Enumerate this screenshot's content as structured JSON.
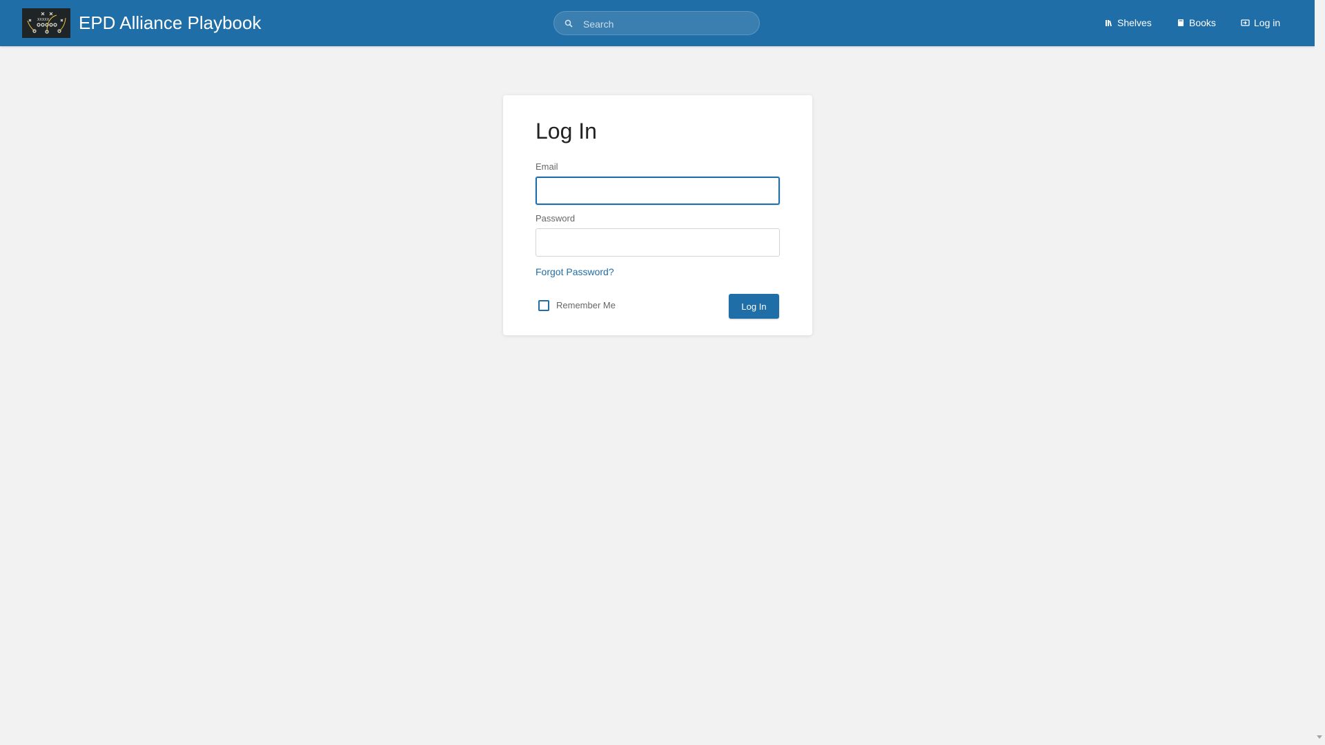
{
  "header": {
    "site_title": "EPD Alliance Playbook",
    "logo_icon": "playbook-diagram-logo",
    "search": {
      "placeholder": "Search",
      "icon": "search-icon"
    },
    "nav": [
      {
        "label": "Shelves",
        "icon": "shelves-icon"
      },
      {
        "label": "Books",
        "icon": "book-icon"
      },
      {
        "label": "Log in",
        "icon": "login-icon"
      }
    ]
  },
  "login_form": {
    "title": "Log In",
    "email_label": "Email",
    "email_value": "",
    "password_label": "Password",
    "password_value": "",
    "forgot_password": "Forgot Password?",
    "remember_me": "Remember Me",
    "remember_checked": false,
    "submit_label": "Log In"
  },
  "colors": {
    "primary": "#206ea7",
    "background": "#f2f2f2",
    "card": "#ffffff"
  }
}
